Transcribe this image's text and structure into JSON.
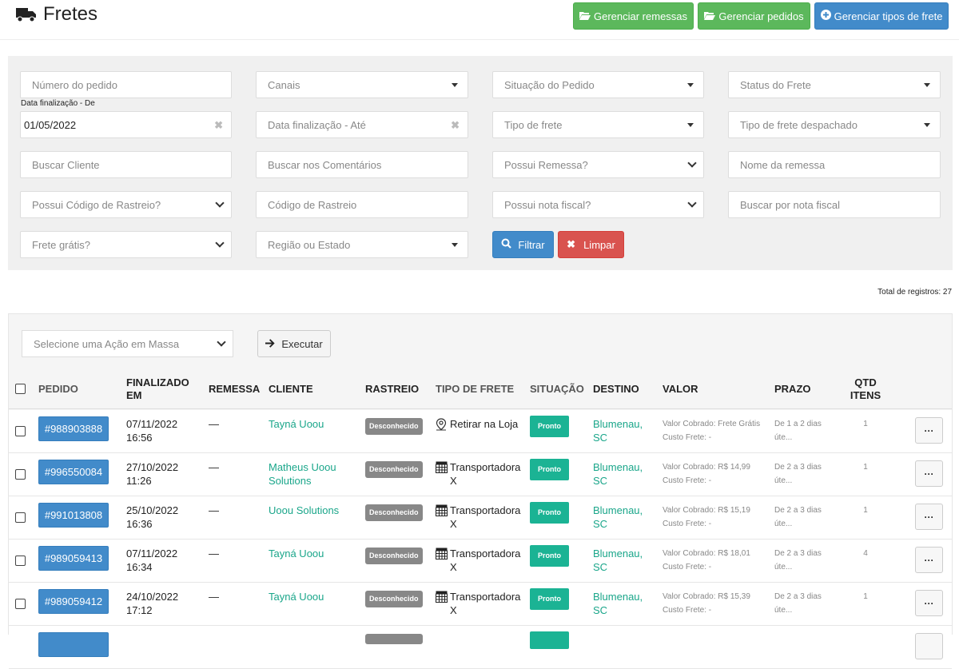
{
  "header": {
    "title": "Fretes",
    "buttons": [
      {
        "label": "Gerenciar remessas",
        "icon": "folder-open-icon"
      },
      {
        "label": "Gerenciar pedidos",
        "icon": "folder-open-icon"
      },
      {
        "label": "Gerenciar tipos de frete",
        "icon": "plus-circle-icon"
      }
    ]
  },
  "filters": {
    "numero_pedido": "Número do pedido",
    "canais": "Canais",
    "situacao_pedido": "Situação do Pedido",
    "status_frete": "Status do Frete",
    "data_de_label": "Data finalização - De",
    "data_de_value": "01/05/2022",
    "data_ate": "Data finalização - Até",
    "tipo_frete": "Tipo de frete",
    "tipo_frete_despachado": "Tipo de frete despachado",
    "buscar_cliente": "Buscar Cliente",
    "buscar_comentarios": "Buscar nos Comentários",
    "possui_remessa": "Possui Remessa?",
    "nome_remessa": "Nome da remessa",
    "possui_rastreio": "Possui Código de Rastreio?",
    "codigo_rastreio": "Código de Rastreio",
    "possui_nota": "Possui nota fiscal?",
    "buscar_nota": "Buscar por nota fiscal",
    "frete_gratis": "Frete grátis?",
    "regiao_estado": "Região ou Estado",
    "filtrar": "Filtrar",
    "limpar": "Limpar"
  },
  "total_registros": "Total de registros: 27",
  "mass_action": {
    "placeholder": "Selecione uma Ação em Massa",
    "execute": "Executar"
  },
  "table": {
    "headers": {
      "pedido": "PEDIDO",
      "finalizado_em": "FINALIZADO EM",
      "remessa": "REMESSA",
      "cliente": "CLIENTE",
      "rastreio": "RASTREIO",
      "tipo_frete": "TIPO DE FRETE",
      "situacao": "SITUAÇÃO",
      "destino": "DESTINO",
      "valor": "VALOR",
      "prazo": "PRAZO",
      "qtd_itens": "QTD ITENS"
    },
    "rows": [
      {
        "pedido": "#988903888",
        "data": "07/11/2022",
        "hora": "16:56",
        "remessa": "—",
        "cliente": "Tayná Uoou",
        "rastreio": "Desconhecido",
        "tipo_icon": "map-pin-icon",
        "tipo": "Retirar na Loja",
        "situacao": "Pronto",
        "destino": "Blumenau, SC",
        "valor_cobrado": "Valor Cobrado: Frete Grátis",
        "custo": "Custo Frete: -",
        "prazo": "De 1 a 2 dias úte...",
        "qtd": "1"
      },
      {
        "pedido": "#996550084",
        "data": "27/10/2022",
        "hora": "11:26",
        "remessa": "—",
        "cliente": "Matheus Uoou Solutions",
        "rastreio": "Desconhecido",
        "tipo_icon": "truck-table-icon",
        "tipo": "Transportadora X",
        "situacao": "Pronto",
        "destino": "Blumenau, SC",
        "valor_cobrado": "Valor Cobrado: R$ 14,99",
        "custo": "Custo Frete: -",
        "prazo": "De 2 a 3 dias úte...",
        "qtd": "1"
      },
      {
        "pedido": "#991013808",
        "data": "25/10/2022",
        "hora": "16:36",
        "remessa": "—",
        "cliente": "Uoou Solutions",
        "rastreio": "Desconhecido",
        "tipo_icon": "truck-table-icon",
        "tipo": "Transportadora X",
        "situacao": "Pronto",
        "destino": "Blumenau, SC",
        "valor_cobrado": "Valor Cobrado: R$ 15,19",
        "custo": "Custo Frete: -",
        "prazo": "De 2 a 3 dias úte...",
        "qtd": "1"
      },
      {
        "pedido": "#989059413",
        "data": "07/11/2022",
        "hora": "16:34",
        "remessa": "—",
        "cliente": "Tayná Uoou",
        "rastreio": "Desconhecido",
        "tipo_icon": "truck-table-icon",
        "tipo": "Transportadora X",
        "situacao": "Pronto",
        "destino": "Blumenau, SC",
        "valor_cobrado": "Valor Cobrado: R$ 18,01",
        "custo": "Custo Frete: -",
        "prazo": "De 2 a 3 dias úte...",
        "qtd": "4"
      },
      {
        "pedido": "#989059412",
        "data": "24/10/2022",
        "hora": "17:12",
        "remessa": "—",
        "cliente": "Tayná Uoou",
        "rastreio": "Desconhecido",
        "tipo_icon": "truck-table-icon",
        "tipo": "Transportadora X",
        "situacao": "Pronto",
        "destino": "Blumenau, SC",
        "valor_cobrado": "Valor Cobrado: R$ 15,39",
        "custo": "Custo Frete: -",
        "prazo": "De 2 a 3 dias úte...",
        "qtd": "1"
      }
    ]
  }
}
